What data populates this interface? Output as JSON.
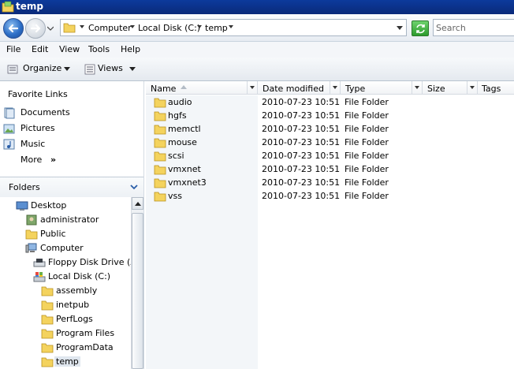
{
  "window": {
    "title": "temp"
  },
  "address": {
    "crumbs": [
      "Computer",
      "Local Disk (C:)",
      "temp"
    ]
  },
  "search": {
    "placeholder": "Search"
  },
  "menu": [
    "File",
    "Edit",
    "View",
    "Tools",
    "Help"
  ],
  "commands": {
    "organize": "Organize",
    "views": "Views"
  },
  "favorites": {
    "header": "Favorite Links",
    "items": [
      {
        "label": "Documents",
        "icon": "documents-icon"
      },
      {
        "label": "Pictures",
        "icon": "pictures-icon"
      },
      {
        "label": "Music",
        "icon": "music-icon"
      },
      {
        "label": "More",
        "icon": "chevron-double-right-icon"
      }
    ]
  },
  "folders_header": "Folders",
  "tree": [
    {
      "label": "Desktop",
      "icon": "desktop-icon",
      "indent": 0
    },
    {
      "label": "administrator",
      "icon": "user-folder-icon",
      "indent": 1
    },
    {
      "label": "Public",
      "icon": "folder-icon",
      "indent": 1
    },
    {
      "label": "Computer",
      "icon": "computer-icon",
      "indent": 1
    },
    {
      "label": "Floppy Disk Drive (A:)",
      "icon": "floppy-drive-icon",
      "indent": 2
    },
    {
      "label": "Local Disk (C:)",
      "icon": "local-disk-icon",
      "indent": 2
    },
    {
      "label": "assembly",
      "icon": "folder-icon",
      "indent": 3
    },
    {
      "label": "inetpub",
      "icon": "folder-icon",
      "indent": 3
    },
    {
      "label": "PerfLogs",
      "icon": "folder-icon",
      "indent": 3
    },
    {
      "label": "Program Files",
      "icon": "folder-icon",
      "indent": 3
    },
    {
      "label": "ProgramData",
      "icon": "folder-icon",
      "indent": 3
    },
    {
      "label": "temp",
      "icon": "folder-icon",
      "indent": 3,
      "selected": true
    }
  ],
  "columns": [
    "Name",
    "Date modified",
    "Type",
    "Size",
    "Tags"
  ],
  "files": [
    {
      "name": "audio",
      "date": "2010-07-23 10:51",
      "type": "File Folder"
    },
    {
      "name": "hgfs",
      "date": "2010-07-23 10:51",
      "type": "File Folder"
    },
    {
      "name": "memctl",
      "date": "2010-07-23 10:51",
      "type": "File Folder"
    },
    {
      "name": "mouse",
      "date": "2010-07-23 10:51",
      "type": "File Folder"
    },
    {
      "name": "scsi",
      "date": "2010-07-23 10:51",
      "type": "File Folder"
    },
    {
      "name": "vmxnet",
      "date": "2010-07-23 10:51",
      "type": "File Folder"
    },
    {
      "name": "vmxnet3",
      "date": "2010-07-23 10:51",
      "type": "File Folder"
    },
    {
      "name": "vss",
      "date": "2010-07-23 10:51",
      "type": "File Folder"
    }
  ]
}
